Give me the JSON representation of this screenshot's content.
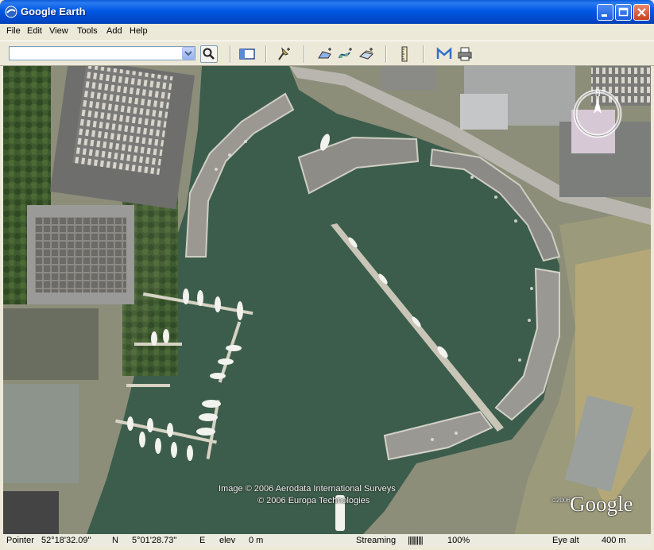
{
  "window": {
    "title": "Google Earth"
  },
  "menu": [
    "File",
    "Edit",
    "View",
    "Tools",
    "Add",
    "Help"
  ],
  "search": {
    "value": ""
  },
  "toolbar_icons": [
    "sidebar-icon",
    "placemark-icon",
    "polygon-icon",
    "path-icon",
    "image-overlay-icon",
    "ruler-icon",
    "email-icon",
    "print-icon"
  ],
  "map": {
    "copyright_line1": "Image © 2006 Aerodata International Surveys",
    "copyright_line2": "© 2006 Europa Technologies",
    "logo_small": "©2006",
    "logo": "Google"
  },
  "status": {
    "pointer_label": "Pointer",
    "lat": "52°18'32.09\"",
    "lat_dir": "N",
    "lon": "5°01'28.73\"",
    "lon_dir": "E",
    "elev_label": "elev",
    "elev_value": "0 m",
    "streaming_label": "Streaming",
    "streaming_bars": "||||||||||",
    "streaming_percent": "100%",
    "eye_alt_label": "Eye alt",
    "eye_alt_value": "400 m"
  },
  "colors": {
    "title_bar": "#0058e4",
    "water": "#3d5d4a",
    "roof": "#8f8f8f"
  }
}
